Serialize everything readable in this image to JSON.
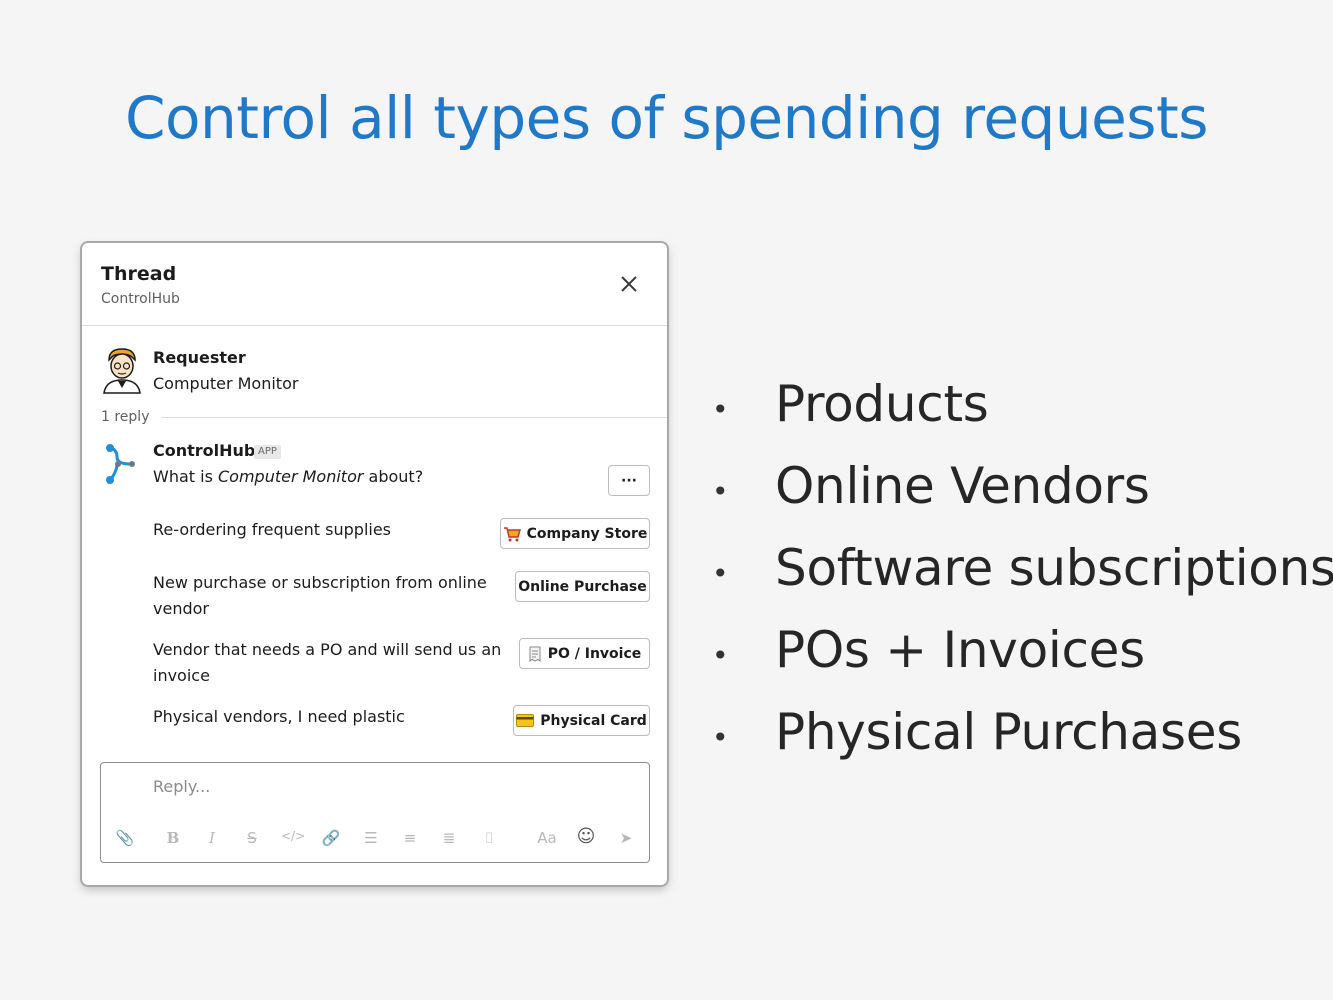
{
  "slide": {
    "title": "Control all types of spending requests",
    "bullets": [
      "Products",
      "Online Vendors",
      "Software subscriptions",
      "POs + Invoices",
      "Physical Purchases"
    ]
  },
  "thread": {
    "title": "Thread",
    "subtitle": "ControlHub",
    "requester": {
      "name": "Requester",
      "text": "Computer Monitor"
    },
    "reply_count": "1 reply",
    "bot": {
      "name": "ControlHub",
      "badge": "APP",
      "question_prefix": "What is ",
      "question_subject": "Computer Monitor",
      "question_suffix": " about?",
      "more_label": "···"
    },
    "options": [
      {
        "text": "Re-ordering frequent supplies",
        "button": "Company Store",
        "icon": "shopping-cart-icon"
      },
      {
        "text": "New purchase or subscription from online vendor",
        "button": "Online Purchase",
        "icon": ""
      },
      {
        "text": "Vendor that needs a PO and will send us an invoice",
        "button": "PO / Invoice",
        "icon": "receipt-icon"
      },
      {
        "text": "Physical vendors, I need plastic",
        "button": "Physical Card",
        "icon": "credit-card-icon"
      }
    ],
    "composer": {
      "placeholder": "Reply...",
      "tools": [
        "attach-icon",
        "bold-icon",
        "italic-icon",
        "strikethrough-icon",
        "code-icon",
        "link-icon",
        "ordered-list-icon",
        "bulleted-list-icon",
        "indent-icon",
        "code-block-icon",
        "format-icon",
        "emoji-icon",
        "send-icon"
      ]
    }
  }
}
